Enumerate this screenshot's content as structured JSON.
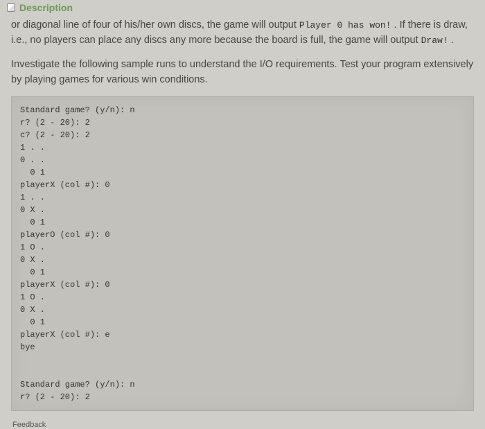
{
  "header": {
    "title": "Description"
  },
  "content": {
    "para1_pre": "or diagonal line of four of his/her own discs, the game will output ",
    "para1_code": "Player 0 has won!",
    "para1_mid": " . If there is draw, i.e., no players can place any discs any more because the board is full, the game will output ",
    "para1_code2": "Draw!",
    "para1_end": " .",
    "para2": "Investigate the following sample runs to understand the I/O requirements. Test your program extensively by playing games for various win conditions."
  },
  "code": {
    "block": "Standard game? (y/n): n\nr? (2 - 20): 2\nc? (2 - 20): 2\n1 . .\n0 . .\n  0 1\nplayerX (col #): 0\n1 . .\n0 X .\n  0 1\nplayerO (col #): 0\n1 O .\n0 X .\n  0 1\nplayerX (col #): 0\n1 O .\n0 X .\n  0 1\nplayerX (col #): e\nbye\n\n\nStandard game? (y/n): n\nr? (2 - 20): 2"
  },
  "footer": {
    "cut": "Feedback"
  }
}
